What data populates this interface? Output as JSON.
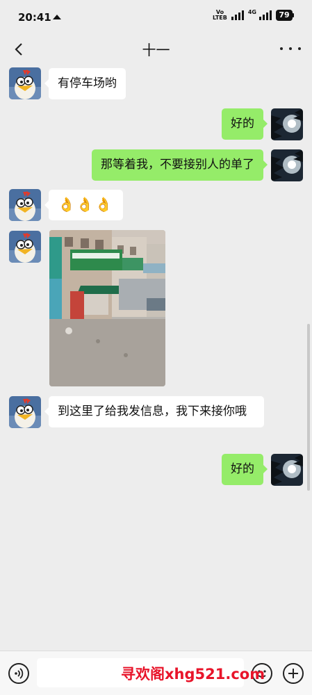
{
  "status_bar": {
    "time": "20:41",
    "volte_top": "Vo",
    "volte_bottom": "LTE",
    "volte_sub": "B",
    "network": "4G",
    "battery": "79"
  },
  "nav": {
    "title": "十一"
  },
  "messages": [
    {
      "side": "in",
      "kind": "text",
      "text": "有停车场哟"
    },
    {
      "side": "out",
      "kind": "text",
      "text": "好的"
    },
    {
      "side": "out",
      "kind": "text",
      "text": "那等着我，不要接别人的单了"
    },
    {
      "side": "in",
      "kind": "emoji",
      "text": "👌👌👌"
    },
    {
      "side": "in",
      "kind": "image",
      "text": ""
    },
    {
      "side": "in",
      "kind": "text",
      "text": "到这里了给我发信息，我下来接你哦"
    },
    {
      "side": "out",
      "kind": "text",
      "text": "好的"
    }
  ],
  "input": {
    "placeholder": ""
  },
  "watermark": "寻欢阁xhg521.com",
  "colors": {
    "background": "#ededed",
    "outgoing_bubble": "#95ec69",
    "incoming_bubble": "#ffffff",
    "watermark": "#e8142a"
  },
  "icons": [
    "back-icon",
    "more-icon",
    "voice-icon",
    "emoji-icon",
    "plus-icon"
  ]
}
